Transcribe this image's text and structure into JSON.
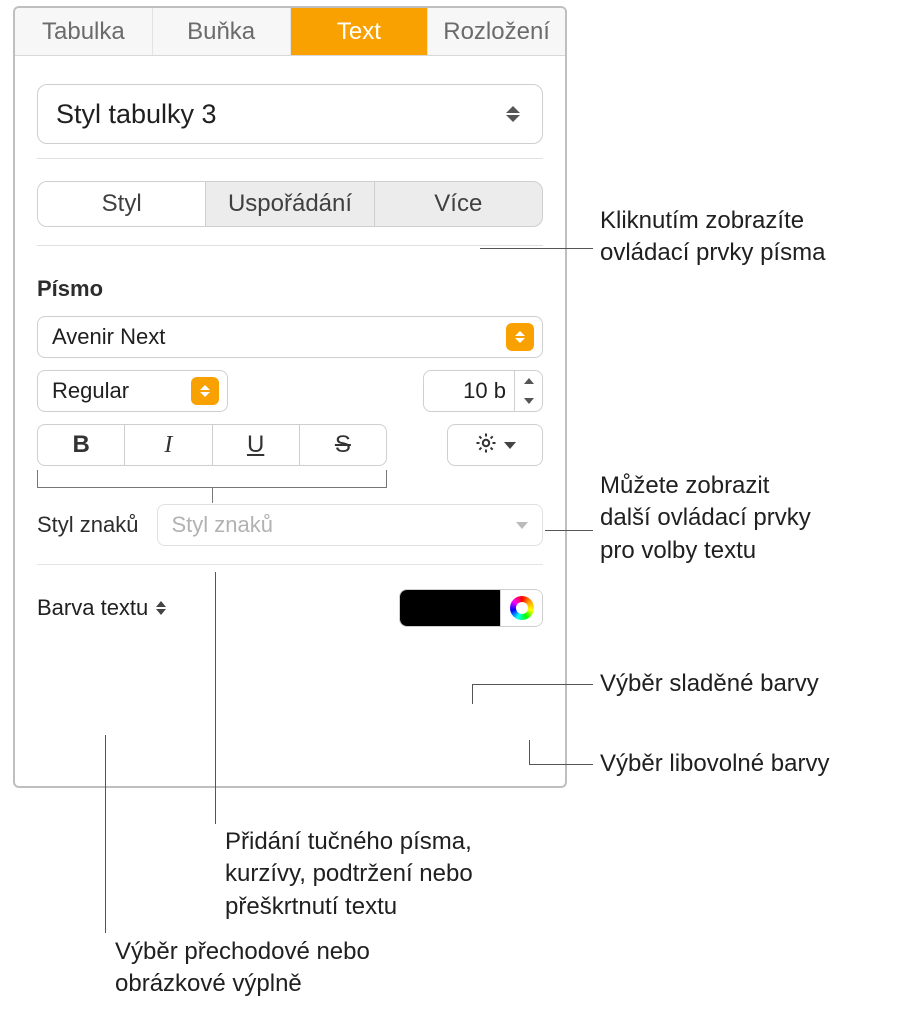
{
  "topTabs": {
    "t1": "Tabulka",
    "t2": "Buňka",
    "t3": "Text",
    "t4": "Rozložení"
  },
  "styleDropdown": "Styl tabulky 3",
  "seg": {
    "s1": "Styl",
    "s2": "Uspořádání",
    "s3": "Více"
  },
  "fontSection": "Písmo",
  "fontFamily": "Avenir Next",
  "fontWeight": "Regular",
  "fontSize": "10 b",
  "bius": {
    "b": "B",
    "i": "I",
    "u": "U",
    "s": "S"
  },
  "charStyleLabel": "Styl znaků",
  "charStylePlaceholder": "Styl znaků",
  "textColorLabel": "Barva textu",
  "callouts": {
    "c1": "Kliknutím zobrazíte ovládací prvky písma",
    "c2l1": "Můžete zobrazit",
    "c2l2": "další ovládací prvky",
    "c2l3": "pro volby textu",
    "c3": "Výběr sladěné barvy",
    "c4": "Výběr libovolné barvy",
    "c5l1": "Přidání tučného písma,",
    "c5l2": "kurzívy, podtržení nebo",
    "c5l3": "přeškrtnutí textu",
    "c6l1": "Výběr přechodové nebo",
    "c6l2": "obrázkové výplně"
  }
}
